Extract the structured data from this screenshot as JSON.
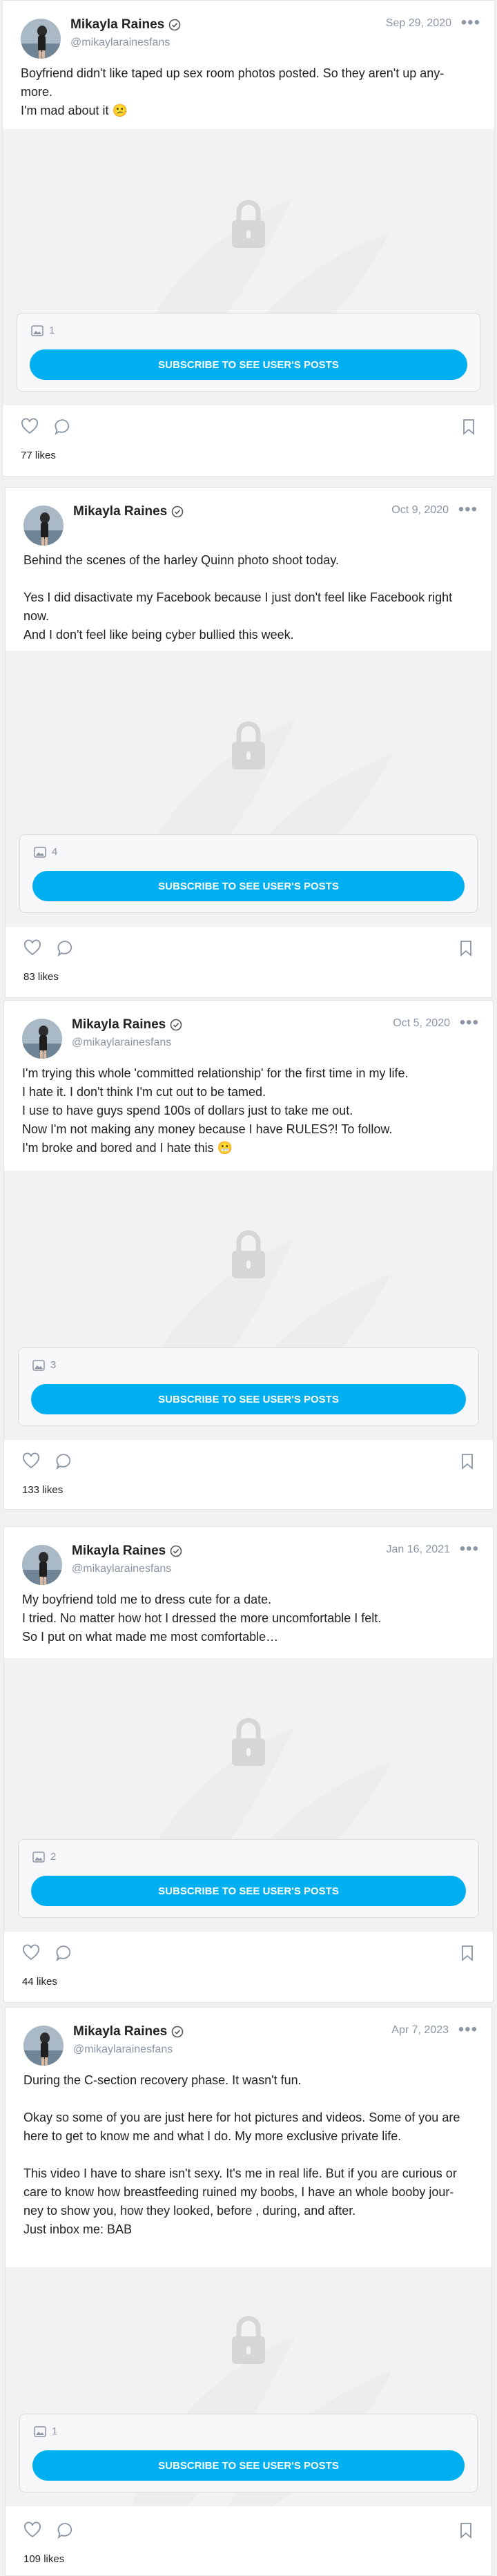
{
  "posts": [
    {
      "author": "Mikayla Raines",
      "handle": "@mikaylarainesfans",
      "date": "Sep 29, 2020",
      "text": [
        "Boyfriend didn't like taped up sex room photos posted. So they aren't up any-",
        "more.",
        "I'm mad about it 😕"
      ],
      "media_count": "1",
      "subscribe_label": "SUBSCRIBE TO SEE USER'S POSTS",
      "likes": "77 likes"
    },
    {
      "author": "Mikayla Raines",
      "handle": "",
      "date": "Oct 9, 2020",
      "text": [
        "Behind the scenes of the harley Quinn photo shoot today.",
        "",
        "Yes I did disactivate my Facebook because I just don't feel like Facebook right",
        "now.",
        "And I don't feel like being cyber bullied this week."
      ],
      "media_count": "4",
      "subscribe_label": "SUBSCRIBE TO SEE USER'S POSTS",
      "likes": "83 likes"
    },
    {
      "author": "Mikayla Raines",
      "handle": "@mikaylarainesfans",
      "date": "Oct 5, 2020",
      "text": [
        "I'm trying this whole 'committed relationship' for the first time in my life.",
        "I hate it. I don't think I'm cut out to be tamed.",
        "I use to have guys spend 100s of dollars just to take me out.",
        "Now I'm not making any money because I have RULES?! To follow.",
        "I'm broke and bored and I hate this 😬"
      ],
      "media_count": "3",
      "subscribe_label": "SUBSCRIBE TO SEE USER'S POSTS",
      "likes": "133 likes"
    },
    {
      "author": "Mikayla Raines",
      "handle": "@mikaylarainesfans",
      "date": "Jan 16, 2021",
      "text": [
        "My boyfriend told me to dress cute for a date.",
        "I tried. No matter how hot I dressed the more uncomfortable I felt.",
        "So I put on what made me most comfortable…"
      ],
      "media_count": "2",
      "subscribe_label": "SUBSCRIBE TO SEE USER'S POSTS",
      "likes": "44 likes"
    },
    {
      "author": "Mikayla Raines",
      "handle": "@mikaylarainesfans",
      "date": "Apr 7, 2023",
      "text": [
        "During the C-section recovery phase. It wasn't fun.",
        "",
        "Okay so some of you are just here for hot pictures and videos. Some of you are",
        "here to get to know me and what I do. My more exclusive private life.",
        "",
        "This video I have to share isn't sexy. It's me in real life. But if you are curious or",
        "care to know how breastfeeding ruined my boobs, I have an whole booby jour-",
        "ney to show you, how they looked, before , during, and after.",
        "Just inbox me: BAB"
      ],
      "media_count": "1",
      "subscribe_label": "SUBSCRIBE TO SEE USER'S POSTS",
      "likes": "109 likes"
    }
  ],
  "colors": {
    "accent": "#00aff0",
    "muted": "#8a96a3",
    "locked_bg": "#f2f2f4"
  },
  "icons": [
    "verified-icon",
    "more-icon",
    "lock-icon",
    "image-icon",
    "heart-icon",
    "comment-icon",
    "bookmark-icon"
  ]
}
